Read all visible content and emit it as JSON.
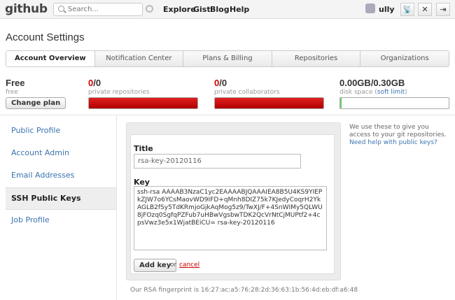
{
  "header": {
    "logo": "github",
    "search_placeholder": "Search...",
    "nav": [
      "Explore",
      "Gist",
      "Blog",
      "Help"
    ],
    "username": "ully",
    "icons": [
      "notifications-icon",
      "account-settings-icon",
      "logout-icon"
    ]
  },
  "page": {
    "title": "Account Settings"
  },
  "tabs": [
    {
      "label": "Account Overview",
      "active": true
    },
    {
      "label": "Notification Center",
      "active": false
    },
    {
      "label": "Plans & Billing",
      "active": false
    },
    {
      "label": "Repositories",
      "active": false
    },
    {
      "label": "Organizations",
      "active": false
    }
  ],
  "plan": {
    "name": "Free",
    "sub": "free",
    "change_label": "Change plan",
    "private_repos": {
      "used": "0",
      "total": "/0",
      "label": "private repositories",
      "fill_fraction": 1.0
    },
    "private_collaborators": {
      "used": "0",
      "total": "/0",
      "label": "private collaborators",
      "fill_fraction": 1.0
    },
    "disk": {
      "used": "0.00GB",
      "total": "/0.30GB",
      "label": "disk space",
      "limit_label": "soft limit",
      "fill_fraction": 0.0
    }
  },
  "sidebar": {
    "items": [
      {
        "label": "Public Profile"
      },
      {
        "label": "Account Admin"
      },
      {
        "label": "Email Addresses"
      },
      {
        "label": "SSH Public Keys",
        "active": true
      },
      {
        "label": "Job Profile"
      }
    ]
  },
  "form": {
    "title_label": "Title",
    "title_value": "rsa-key-20120116",
    "key_label": "Key",
    "key_value": "ssh-rsa AAAAB3NzaC1yc2EAAAABJQAAAIEA8B5U4KS9YIEPkZJW7o6YCsMaovWD9IFD+qMnh8DIZ75k7KJedyCoqrH2YkAGLB2fSy5TdKRmjoGjkAqMog5z9/TwXJ/F+4SnWIMy5QLWU8jFOzq0SgfqPZFub7uHBwVgsbwTDK2QcVrNtCjMUPtf2+4cpsVwz3e5x1WjatBEiCU= rsa-key-20120116",
    "add_label": "Add key",
    "or_label": "or",
    "cancel_label": "cancel",
    "fingerprint": "Our RSA fingerprint is 16:27:ac:a5:76:28:2d:36:63:1b:56:4d:eb:df:a6:48"
  },
  "help": {
    "text": "We use these to give you access to your git repositories.",
    "link": "Need help with public keys?"
  },
  "colors": {
    "link": "#3b73af",
    "red": "#c00000",
    "bar_red": "#d01010"
  }
}
